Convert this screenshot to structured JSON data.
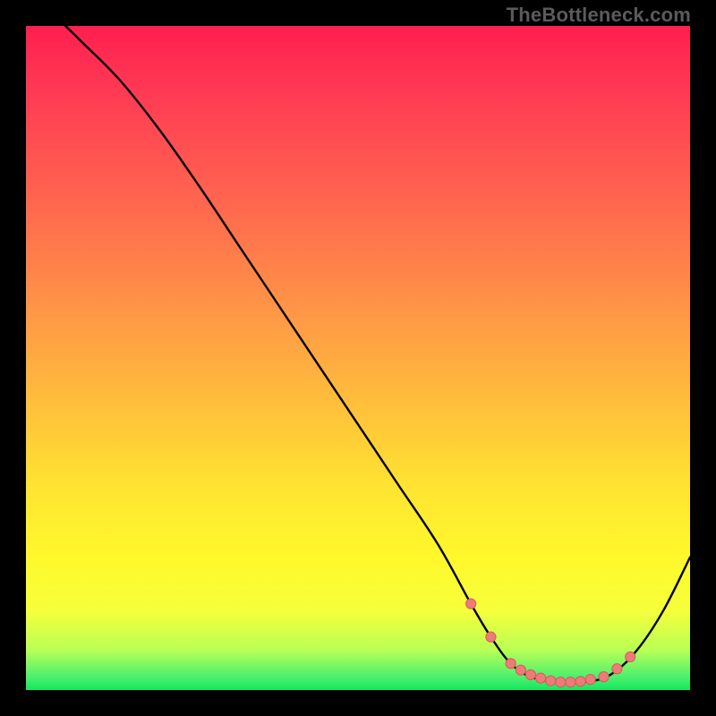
{
  "attribution": "TheBottleneck.com",
  "colors": {
    "background": "#000000",
    "gradient_top": "#ff1f4f",
    "gradient_bottom": "#14e75d",
    "curve": "#000000",
    "marker_fill": "#ee7a79",
    "marker_stroke": "#da5a59"
  },
  "chart_data": {
    "type": "line",
    "title": "",
    "xlabel": "",
    "ylabel": "",
    "xlim": [
      0,
      100
    ],
    "ylim": [
      0,
      100
    ],
    "grid": false,
    "series": [
      {
        "name": "curve",
        "x": [
          0,
          3,
          8,
          14,
          20,
          26,
          32,
          38,
          44,
          50,
          56,
          62,
          67,
          70,
          73,
          76,
          80,
          84,
          88,
          92,
          96,
          100
        ],
        "y": [
          107,
          103,
          98,
          92,
          84.5,
          76,
          67,
          58,
          49,
          40,
          31,
          22,
          13,
          8,
          4,
          2,
          1.2,
          1.2,
          2.3,
          6,
          12,
          20
        ]
      }
    ],
    "markers": {
      "series": "curve",
      "x": [
        67,
        70,
        73,
        74.5,
        76,
        77.5,
        79,
        80.5,
        82,
        83.5,
        85,
        87,
        89,
        91
      ],
      "y": [
        13,
        8,
        4,
        3,
        2.3,
        1.8,
        1.4,
        1.2,
        1.2,
        1.3,
        1.6,
        2.0,
        3.2,
        5
      ]
    }
  }
}
